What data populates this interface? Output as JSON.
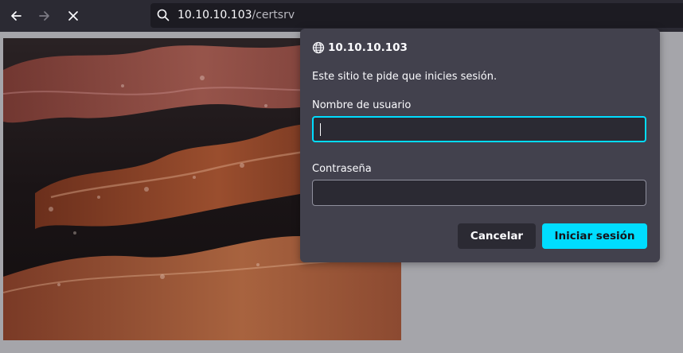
{
  "browser": {
    "url_host": "10.10.10.103",
    "url_path": "/certsrv",
    "icons": {
      "back": "arrow-left-icon",
      "forward": "arrow-right-icon",
      "stop": "close-icon",
      "search": "search-icon"
    }
  },
  "auth_dialog": {
    "host": "10.10.10.103",
    "message": "Este sitio te pide que inicies sesión.",
    "username_label": "Nombre de usuario",
    "username_value": "",
    "password_label": "Contraseña",
    "password_value": "",
    "cancel_label": "Cancelar",
    "login_label": "Iniciar sesión"
  },
  "colors": {
    "toolbar": "#2b2a33",
    "dialog": "#42414d",
    "accent": "#00ddff"
  }
}
